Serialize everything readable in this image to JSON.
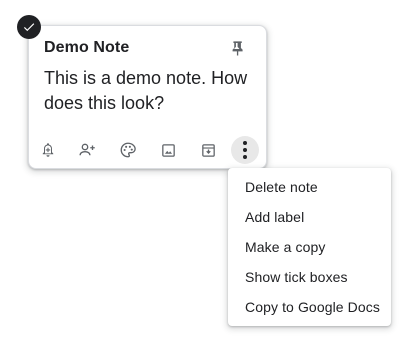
{
  "note": {
    "title": "Demo Note",
    "body": "This is a demo note. How does this look?",
    "selected": true
  },
  "toolbar": {
    "icons": [
      "remind-me-icon",
      "collaborator-icon",
      "background-options-icon",
      "add-image-icon",
      "archive-icon",
      "more-options-icon"
    ]
  },
  "menu": {
    "items": [
      {
        "label": "Delete note"
      },
      {
        "label": "Add label"
      },
      {
        "label": "Make a copy"
      },
      {
        "label": "Show tick boxes"
      },
      {
        "label": "Copy to Google Docs"
      }
    ]
  },
  "colors": {
    "text": "#202124",
    "icon": "#5f6368",
    "border": "#dadce0",
    "active_button_bg": "#e8e8e8"
  }
}
